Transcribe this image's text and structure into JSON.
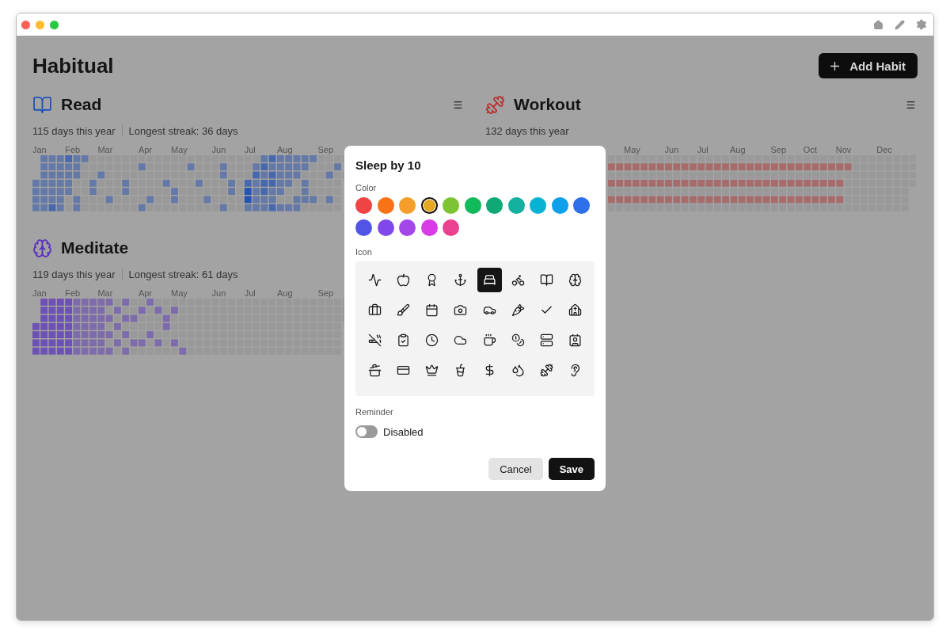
{
  "app": {
    "title": "Habitual",
    "add_button": "Add Habit"
  },
  "habits": [
    {
      "name": "Read",
      "color": "#2352b8",
      "stats": [
        "115 days this year",
        "Longest streak: 36 days"
      ],
      "months": [
        "Jan",
        "Feb",
        "Mar",
        "Apr",
        "May",
        "Jun",
        "Jul",
        "Aug",
        "Sep"
      ]
    },
    {
      "name": "Workout",
      "color": "#b83232",
      "stats": [
        "132 days this year"
      ],
      "months": [
        "May",
        "Jun",
        "Jul",
        "Aug",
        "Sep",
        "Oct",
        "Nov",
        "Dec"
      ]
    },
    {
      "name": "Meditate",
      "color": "#5a32c0",
      "stats": [
        "119 days this year",
        "Longest streak: 61 days"
      ],
      "months": [
        "Jan",
        "Feb",
        "Mar",
        "Apr",
        "May",
        "Jun",
        "Jul",
        "Aug",
        "Sep"
      ]
    }
  ],
  "dialog": {
    "title": "Sleep by 10",
    "color_label": "Color",
    "colors": [
      {
        "color": "#ef4444",
        "selected": false
      },
      {
        "color": "#f97316",
        "selected": false
      },
      {
        "color": "#f59e2b",
        "selected": false
      },
      {
        "color": "#e5a823",
        "selected": true
      },
      {
        "color": "#7cc432",
        "selected": false
      },
      {
        "color": "#12ba5b",
        "selected": false
      },
      {
        "color": "#10a874",
        "selected": false
      },
      {
        "color": "#14b0a0",
        "selected": false
      },
      {
        "color": "#08b2d3",
        "selected": false
      },
      {
        "color": "#0ea0e9",
        "selected": false
      },
      {
        "color": "#2f6fea",
        "selected": false
      },
      {
        "color": "#5055e6",
        "selected": false
      },
      {
        "color": "#8047ea",
        "selected": false
      },
      {
        "color": "#a447ea",
        "selected": false
      },
      {
        "color": "#d93be6",
        "selected": false
      },
      {
        "color": "#ec4191",
        "selected": false
      }
    ],
    "icon_label": "Icon",
    "icons": [
      {
        "selected": false
      },
      {
        "selected": false
      },
      {
        "selected": false
      },
      {
        "selected": false
      },
      {
        "selected": true
      },
      {
        "selected": false
      },
      {
        "selected": false
      },
      {
        "selected": false
      },
      {
        "selected": false
      },
      {
        "selected": false
      },
      {
        "selected": false
      },
      {
        "selected": false
      },
      {
        "selected": false
      },
      {
        "selected": false
      },
      {
        "selected": false
      },
      {
        "selected": false
      },
      {
        "selected": false
      },
      {
        "selected": false
      },
      {
        "selected": false
      },
      {
        "selected": false
      },
      {
        "selected": false
      },
      {
        "selected": false
      },
      {
        "selected": false
      },
      {
        "selected": false
      },
      {
        "selected": false
      },
      {
        "selected": false
      },
      {
        "selected": false
      },
      {
        "selected": false
      },
      {
        "selected": false
      },
      {
        "selected": false
      },
      {
        "selected": false
      },
      {
        "selected": false
      }
    ],
    "reminder_label": "Reminder",
    "reminder": {
      "on": false,
      "label": "Disabled"
    },
    "buttons": [
      {
        "label": "Cancel",
        "kind": "secondary"
      },
      {
        "label": "Save",
        "kind": "primary"
      }
    ]
  }
}
